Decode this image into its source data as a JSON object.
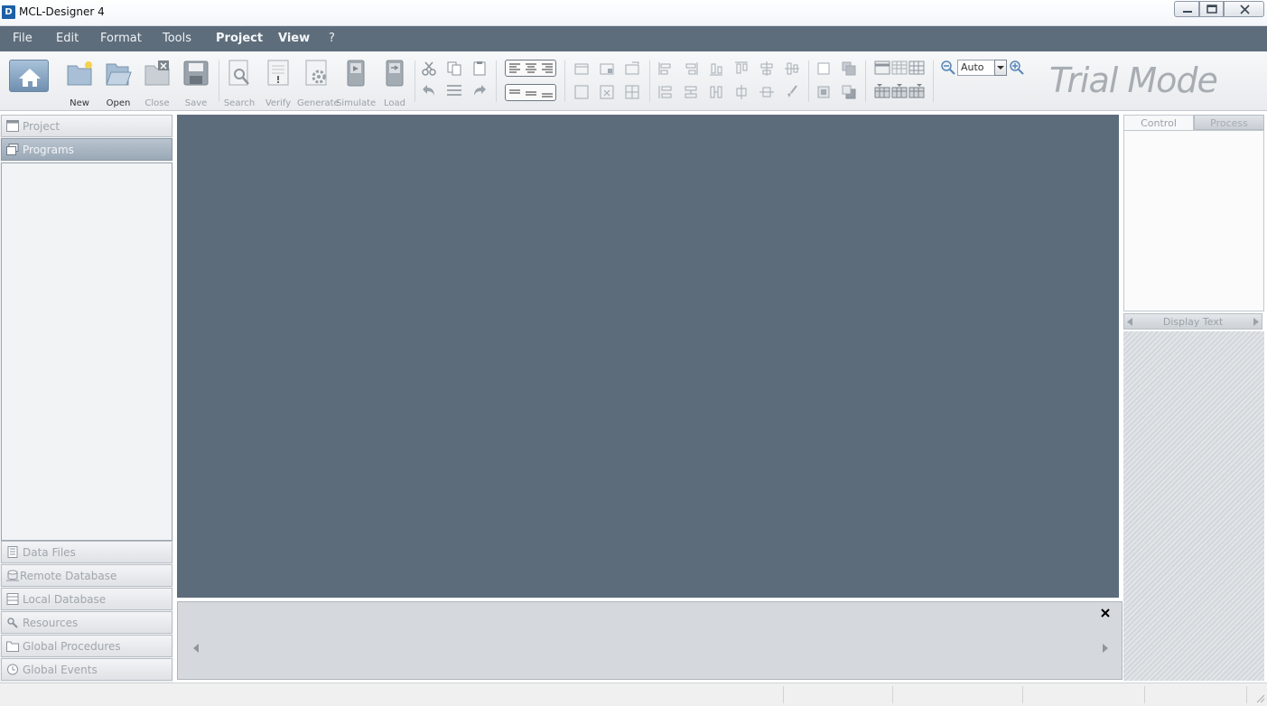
{
  "window": {
    "app_icon_letter": "D",
    "title": "MCL-Designer 4",
    "controls": [
      "minimize-icon",
      "maximize-icon",
      "close-icon"
    ]
  },
  "menu": {
    "items": [
      {
        "label": "File"
      },
      {
        "label": "Edit"
      },
      {
        "label": "Format"
      },
      {
        "label": "Tools"
      },
      {
        "label": "Project"
      },
      {
        "label": "View"
      },
      {
        "label": "?"
      }
    ]
  },
  "toolbar": {
    "buttons": [
      {
        "label": "New",
        "icon": "new-folder-icon"
      },
      {
        "label": "Open",
        "icon": "open-folder-icon"
      },
      {
        "label": "Close",
        "icon": "close-folder-icon"
      },
      {
        "label": "Save",
        "icon": "save-disk-icon"
      },
      {
        "label": "Search",
        "icon": "search-document-icon"
      },
      {
        "label": "Verify",
        "icon": "verify-document-icon"
      },
      {
        "label": "Generate",
        "icon": "generate-gear-icon"
      },
      {
        "label": "Simulate",
        "icon": "simulate-device-icon"
      },
      {
        "label": "Load",
        "icon": "load-device-icon"
      }
    ],
    "zoom": {
      "value": "Auto"
    },
    "watermark": "Trial Mode"
  },
  "left_panel": {
    "top_sections": [
      {
        "label": "Project",
        "icon": "project-window-icon"
      },
      {
        "label": "Programs",
        "icon": "programs-stack-icon"
      }
    ],
    "bottom_sections": [
      {
        "label": "Data Files",
        "icon": "data-files-icon"
      },
      {
        "label": "Remote Database",
        "icon": "remote-database-icon"
      },
      {
        "label": "Local Database",
        "icon": "local-database-icon"
      },
      {
        "label": "Resources",
        "icon": "resources-icon"
      },
      {
        "label": "Global Procedures",
        "icon": "global-procedures-icon"
      },
      {
        "label": "Global Events",
        "icon": "global-events-icon"
      }
    ]
  },
  "right_panel": {
    "tabs": [
      {
        "label": "Control"
      },
      {
        "label": "Process"
      }
    ],
    "nav_label": "Display Text"
  },
  "colors": {
    "menubar": "#5e6d7b",
    "canvas": "#5d6c7b",
    "bottom_pane": "#d5d9de"
  }
}
